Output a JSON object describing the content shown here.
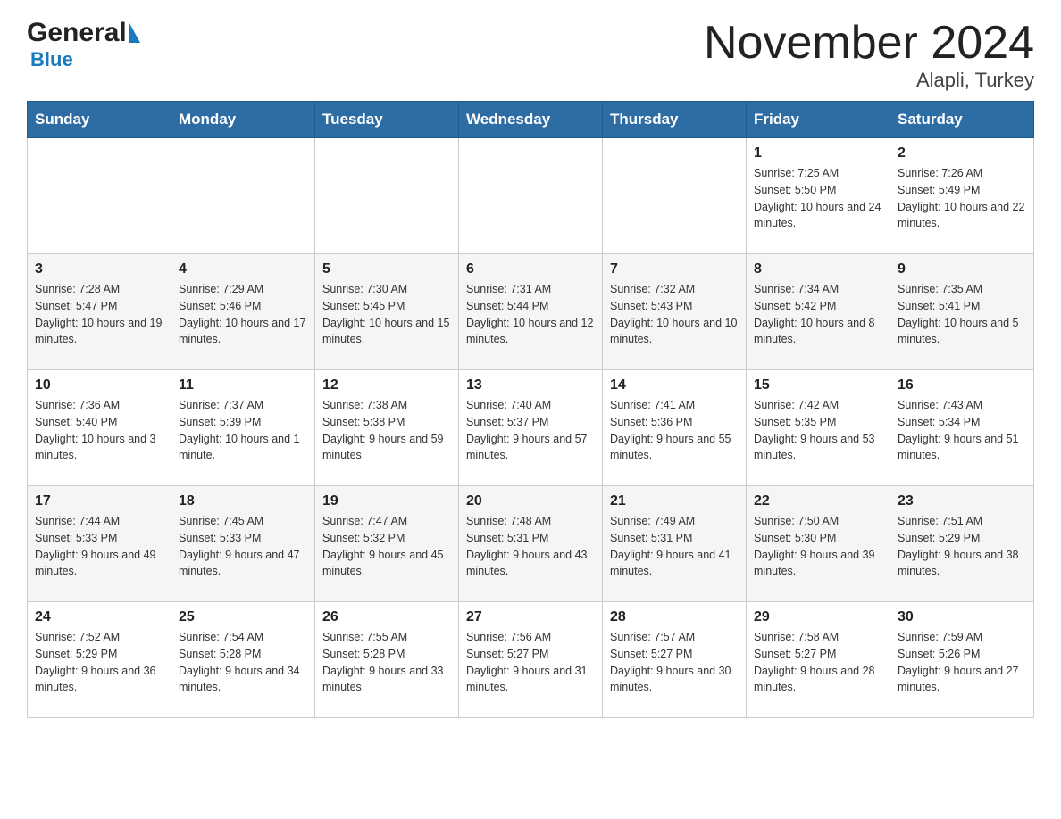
{
  "header": {
    "logo_general": "General",
    "logo_blue": "Blue",
    "title": "November 2024",
    "subtitle": "Alapli, Turkey"
  },
  "days_of_week": [
    "Sunday",
    "Monday",
    "Tuesday",
    "Wednesday",
    "Thursday",
    "Friday",
    "Saturday"
  ],
  "weeks": [
    [
      {
        "day": "",
        "sunrise": "",
        "sunset": "",
        "daylight": ""
      },
      {
        "day": "",
        "sunrise": "",
        "sunset": "",
        "daylight": ""
      },
      {
        "day": "",
        "sunrise": "",
        "sunset": "",
        "daylight": ""
      },
      {
        "day": "",
        "sunrise": "",
        "sunset": "",
        "daylight": ""
      },
      {
        "day": "",
        "sunrise": "",
        "sunset": "",
        "daylight": ""
      },
      {
        "day": "1",
        "sunrise": "Sunrise: 7:25 AM",
        "sunset": "Sunset: 5:50 PM",
        "daylight": "Daylight: 10 hours and 24 minutes."
      },
      {
        "day": "2",
        "sunrise": "Sunrise: 7:26 AM",
        "sunset": "Sunset: 5:49 PM",
        "daylight": "Daylight: 10 hours and 22 minutes."
      }
    ],
    [
      {
        "day": "3",
        "sunrise": "Sunrise: 7:28 AM",
        "sunset": "Sunset: 5:47 PM",
        "daylight": "Daylight: 10 hours and 19 minutes."
      },
      {
        "day": "4",
        "sunrise": "Sunrise: 7:29 AM",
        "sunset": "Sunset: 5:46 PM",
        "daylight": "Daylight: 10 hours and 17 minutes."
      },
      {
        "day": "5",
        "sunrise": "Sunrise: 7:30 AM",
        "sunset": "Sunset: 5:45 PM",
        "daylight": "Daylight: 10 hours and 15 minutes."
      },
      {
        "day": "6",
        "sunrise": "Sunrise: 7:31 AM",
        "sunset": "Sunset: 5:44 PM",
        "daylight": "Daylight: 10 hours and 12 minutes."
      },
      {
        "day": "7",
        "sunrise": "Sunrise: 7:32 AM",
        "sunset": "Sunset: 5:43 PM",
        "daylight": "Daylight: 10 hours and 10 minutes."
      },
      {
        "day": "8",
        "sunrise": "Sunrise: 7:34 AM",
        "sunset": "Sunset: 5:42 PM",
        "daylight": "Daylight: 10 hours and 8 minutes."
      },
      {
        "day": "9",
        "sunrise": "Sunrise: 7:35 AM",
        "sunset": "Sunset: 5:41 PM",
        "daylight": "Daylight: 10 hours and 5 minutes."
      }
    ],
    [
      {
        "day": "10",
        "sunrise": "Sunrise: 7:36 AM",
        "sunset": "Sunset: 5:40 PM",
        "daylight": "Daylight: 10 hours and 3 minutes."
      },
      {
        "day": "11",
        "sunrise": "Sunrise: 7:37 AM",
        "sunset": "Sunset: 5:39 PM",
        "daylight": "Daylight: 10 hours and 1 minute."
      },
      {
        "day": "12",
        "sunrise": "Sunrise: 7:38 AM",
        "sunset": "Sunset: 5:38 PM",
        "daylight": "Daylight: 9 hours and 59 minutes."
      },
      {
        "day": "13",
        "sunrise": "Sunrise: 7:40 AM",
        "sunset": "Sunset: 5:37 PM",
        "daylight": "Daylight: 9 hours and 57 minutes."
      },
      {
        "day": "14",
        "sunrise": "Sunrise: 7:41 AM",
        "sunset": "Sunset: 5:36 PM",
        "daylight": "Daylight: 9 hours and 55 minutes."
      },
      {
        "day": "15",
        "sunrise": "Sunrise: 7:42 AM",
        "sunset": "Sunset: 5:35 PM",
        "daylight": "Daylight: 9 hours and 53 minutes."
      },
      {
        "day": "16",
        "sunrise": "Sunrise: 7:43 AM",
        "sunset": "Sunset: 5:34 PM",
        "daylight": "Daylight: 9 hours and 51 minutes."
      }
    ],
    [
      {
        "day": "17",
        "sunrise": "Sunrise: 7:44 AM",
        "sunset": "Sunset: 5:33 PM",
        "daylight": "Daylight: 9 hours and 49 minutes."
      },
      {
        "day": "18",
        "sunrise": "Sunrise: 7:45 AM",
        "sunset": "Sunset: 5:33 PM",
        "daylight": "Daylight: 9 hours and 47 minutes."
      },
      {
        "day": "19",
        "sunrise": "Sunrise: 7:47 AM",
        "sunset": "Sunset: 5:32 PM",
        "daylight": "Daylight: 9 hours and 45 minutes."
      },
      {
        "day": "20",
        "sunrise": "Sunrise: 7:48 AM",
        "sunset": "Sunset: 5:31 PM",
        "daylight": "Daylight: 9 hours and 43 minutes."
      },
      {
        "day": "21",
        "sunrise": "Sunrise: 7:49 AM",
        "sunset": "Sunset: 5:31 PM",
        "daylight": "Daylight: 9 hours and 41 minutes."
      },
      {
        "day": "22",
        "sunrise": "Sunrise: 7:50 AM",
        "sunset": "Sunset: 5:30 PM",
        "daylight": "Daylight: 9 hours and 39 minutes."
      },
      {
        "day": "23",
        "sunrise": "Sunrise: 7:51 AM",
        "sunset": "Sunset: 5:29 PM",
        "daylight": "Daylight: 9 hours and 38 minutes."
      }
    ],
    [
      {
        "day": "24",
        "sunrise": "Sunrise: 7:52 AM",
        "sunset": "Sunset: 5:29 PM",
        "daylight": "Daylight: 9 hours and 36 minutes."
      },
      {
        "day": "25",
        "sunrise": "Sunrise: 7:54 AM",
        "sunset": "Sunset: 5:28 PM",
        "daylight": "Daylight: 9 hours and 34 minutes."
      },
      {
        "day": "26",
        "sunrise": "Sunrise: 7:55 AM",
        "sunset": "Sunset: 5:28 PM",
        "daylight": "Daylight: 9 hours and 33 minutes."
      },
      {
        "day": "27",
        "sunrise": "Sunrise: 7:56 AM",
        "sunset": "Sunset: 5:27 PM",
        "daylight": "Daylight: 9 hours and 31 minutes."
      },
      {
        "day": "28",
        "sunrise": "Sunrise: 7:57 AM",
        "sunset": "Sunset: 5:27 PM",
        "daylight": "Daylight: 9 hours and 30 minutes."
      },
      {
        "day": "29",
        "sunrise": "Sunrise: 7:58 AM",
        "sunset": "Sunset: 5:27 PM",
        "daylight": "Daylight: 9 hours and 28 minutes."
      },
      {
        "day": "30",
        "sunrise": "Sunrise: 7:59 AM",
        "sunset": "Sunset: 5:26 PM",
        "daylight": "Daylight: 9 hours and 27 minutes."
      }
    ]
  ]
}
